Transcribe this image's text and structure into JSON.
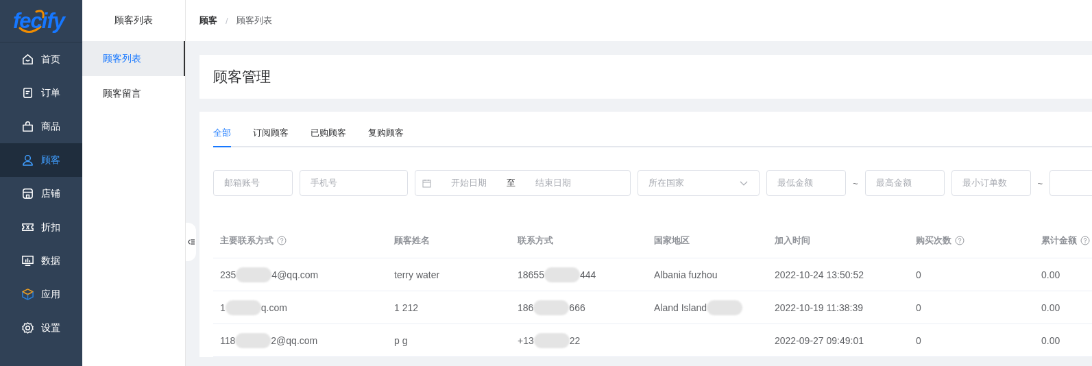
{
  "logo": {
    "text": "fecify"
  },
  "nav": [
    {
      "label": "首页",
      "selected": false
    },
    {
      "label": "订单",
      "selected": false
    },
    {
      "label": "商品",
      "selected": false
    },
    {
      "label": "顾客",
      "selected": true
    },
    {
      "label": "店铺",
      "selected": false
    },
    {
      "label": "折扣",
      "selected": false
    },
    {
      "label": "数据",
      "selected": false
    },
    {
      "label": "应用",
      "selected": false
    },
    {
      "label": "设置",
      "selected": false
    }
  ],
  "submenu": {
    "title": "顾客列表",
    "items": [
      {
        "label": "顾客列表",
        "selected": true
      },
      {
        "label": "顾客留言",
        "selected": false
      }
    ]
  },
  "breadcrumb": {
    "items": [
      "顾客",
      "顾客列表"
    ],
    "separator": "/"
  },
  "page_title": "顾客管理",
  "tabs": [
    {
      "label": "全部",
      "selected": true
    },
    {
      "label": "订阅顾客",
      "selected": false
    },
    {
      "label": "已购顾客",
      "selected": false
    },
    {
      "label": "复购顾客",
      "selected": false
    }
  ],
  "filters": [
    {
      "kind": "text",
      "placeholder": "邮箱账号"
    },
    {
      "kind": "text",
      "placeholder": "手机号"
    },
    {
      "kind": "daterange",
      "start_placeholder": "开始日期",
      "separator": "至",
      "end_placeholder": "结束日期"
    },
    {
      "kind": "select",
      "placeholder": "所在国家"
    },
    {
      "kind": "text",
      "placeholder": "最低金额"
    },
    {
      "kind": "tilde",
      "text": "~"
    },
    {
      "kind": "text",
      "placeholder": "最高金额"
    },
    {
      "kind": "text",
      "placeholder": "最小订单数"
    },
    {
      "kind": "tilde",
      "text": "~"
    },
    {
      "kind": "text"
    }
  ],
  "table": {
    "columns": [
      {
        "label": "主要联系方式",
        "help": true
      },
      {
        "label": "顾客姓名",
        "help": false
      },
      {
        "label": "联系方式",
        "help": false
      },
      {
        "label": "国家地区",
        "help": false
      },
      {
        "label": "加入时间",
        "help": false
      },
      {
        "label": "购买次数",
        "help": true
      },
      {
        "label": "累计金额",
        "help": true
      }
    ],
    "rows": [
      {
        "cells": [
          {
            "text": "235",
            "after": "4@qq.com",
            "redacted": true
          },
          {
            "text": "terry water"
          },
          {
            "text": "18655",
            "after": "444",
            "redacted": true
          },
          {
            "text": "Albania fuzhou"
          },
          {
            "text": "2022-10-24 13:50:52"
          },
          {
            "text": "0"
          },
          {
            "text": "0.00"
          }
        ]
      },
      {
        "cells": [
          {
            "text": "1",
            "after": "q.com",
            "redacted": true
          },
          {
            "text": "1 212"
          },
          {
            "text": "186",
            "after": "666",
            "redacted": true
          },
          {
            "text": "Aland Island",
            "redacted": true
          },
          {
            "text": "2022-10-19 11:38:39"
          },
          {
            "text": "0"
          },
          {
            "text": "0.00"
          }
        ]
      },
      {
        "cells": [
          {
            "text": "118",
            "after": "2@qq.com",
            "redacted": true
          },
          {
            "text": "p g"
          },
          {
            "text": "+13",
            "after": "22",
            "redacted": true
          },
          {},
          {
            "text": "2022-09-27 09:49:01"
          },
          {
            "text": "0"
          },
          {
            "text": "0.00"
          }
        ]
      }
    ]
  }
}
